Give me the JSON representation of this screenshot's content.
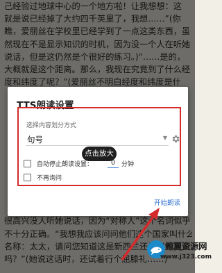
{
  "background_text": [
    "己经验过地球中心的一个地方啦！让我想想：这",
    "就是说已经掉了大约四千英里了，我想……”(你",
    "瞧，爱丽丝在学校里已经学到了一点这类东西，虽",
    "然现在不是显示知识的时机，因为没一个人在听她",
    "说话，但是这仍然是个很好的练习。)“……是的，",
    "大概就是这个距离。那么，我现在究竟到了什么经",
    "度和纬度了呢？”(爱丽丝不明白经度和纬度是什",
    "",
    "",
    "",
    "",
    "",
    "",
    "",
    "",
    "",
    "",
    "很高兴没人听她说话，因为“对称人”这个名词似乎",
    "不十分正确。“我想我应该问问他们这个国家叫什么",
    "名称：太太，请问您知道这是新西兰还是澳大利亚",
    "吗？”(她说这话时，还试着行个屈膝礼……)"
  ],
  "dialog": {
    "title": "TTS朗读设置",
    "section_label": "选择内容划分方式",
    "split_mode": "句号",
    "auto_stop_label": "自动停止朗读设置：",
    "auto_stop_value": "0",
    "auto_stop_unit": "分钟",
    "no_ask_label": "不再询问",
    "start_button": "开始朗读"
  },
  "tooltip": "点击放大",
  "watermark": {
    "title": "鲸夏资源网",
    "url": "www.j323.com"
  },
  "colors": {
    "highlight_box": "#d42a2a",
    "accent": "#2f6fd1"
  },
  "icons": {
    "settings": "gear-icon",
    "dropdown": "chevron-down-icon"
  }
}
